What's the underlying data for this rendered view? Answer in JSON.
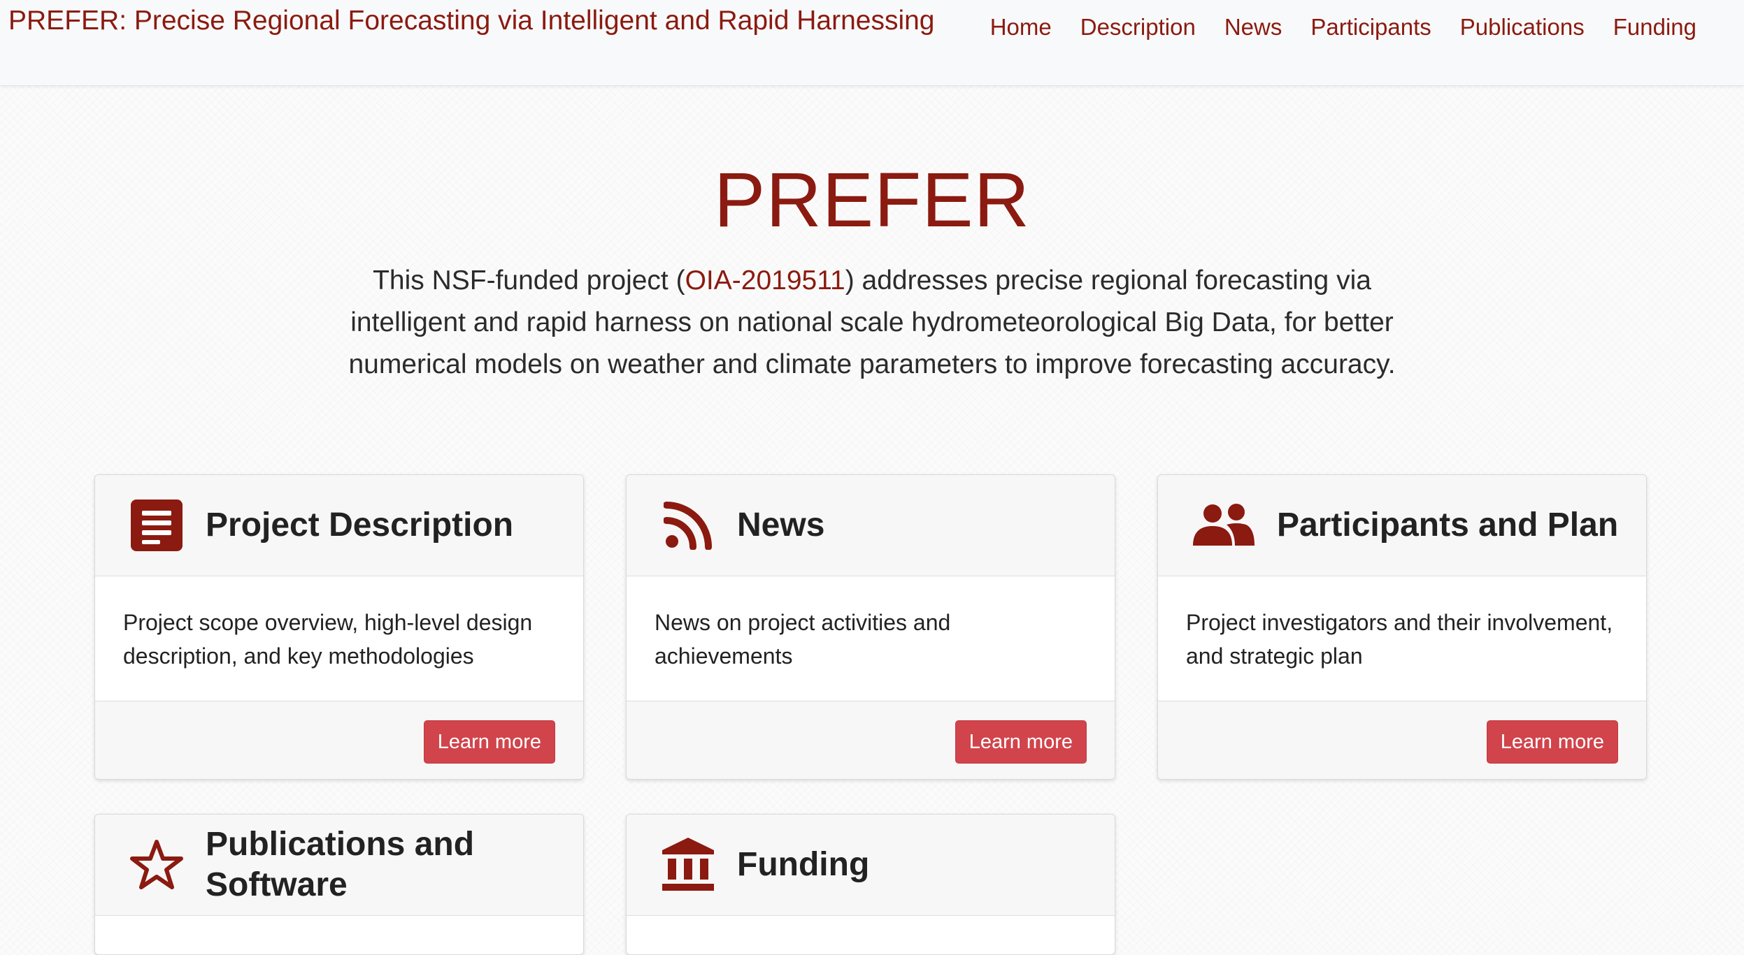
{
  "navbar": {
    "brand": "PREFER: Precise Regional Forecasting via Intelligent and Rapid Harnessing",
    "links": [
      "Home",
      "Description",
      "News",
      "Participants",
      "Publications",
      "Funding"
    ]
  },
  "hero": {
    "title": "PREFER",
    "text_before": "This NSF-funded project (",
    "grant_link": "OIA-2019511",
    "text_after": ") addresses precise regional forecasting via intelligent and rapid harness on national scale hydrometeorological Big Data, for better numerical models on weather and climate parameters to improve forecasting accuracy."
  },
  "cards": [
    {
      "icon": "document-icon",
      "title": "Project Description",
      "body": "Project scope overview, high-level design description, and key methodologies",
      "button": "Learn more"
    },
    {
      "icon": "rss-icon",
      "title": "News",
      "body": "News on project activities and achievements",
      "button": "Learn more"
    },
    {
      "icon": "users-icon",
      "title": "Participants and Plan",
      "body": "Project investigators and their involvement, and strategic plan",
      "button": "Learn more"
    },
    {
      "icon": "star-icon",
      "title": "Publications and Software",
      "body": "",
      "button": ""
    },
    {
      "icon": "bank-icon",
      "title": "Funding",
      "body": "",
      "button": ""
    }
  ],
  "colors": {
    "brand": "#8b1a10",
    "button": "#d1444b"
  }
}
